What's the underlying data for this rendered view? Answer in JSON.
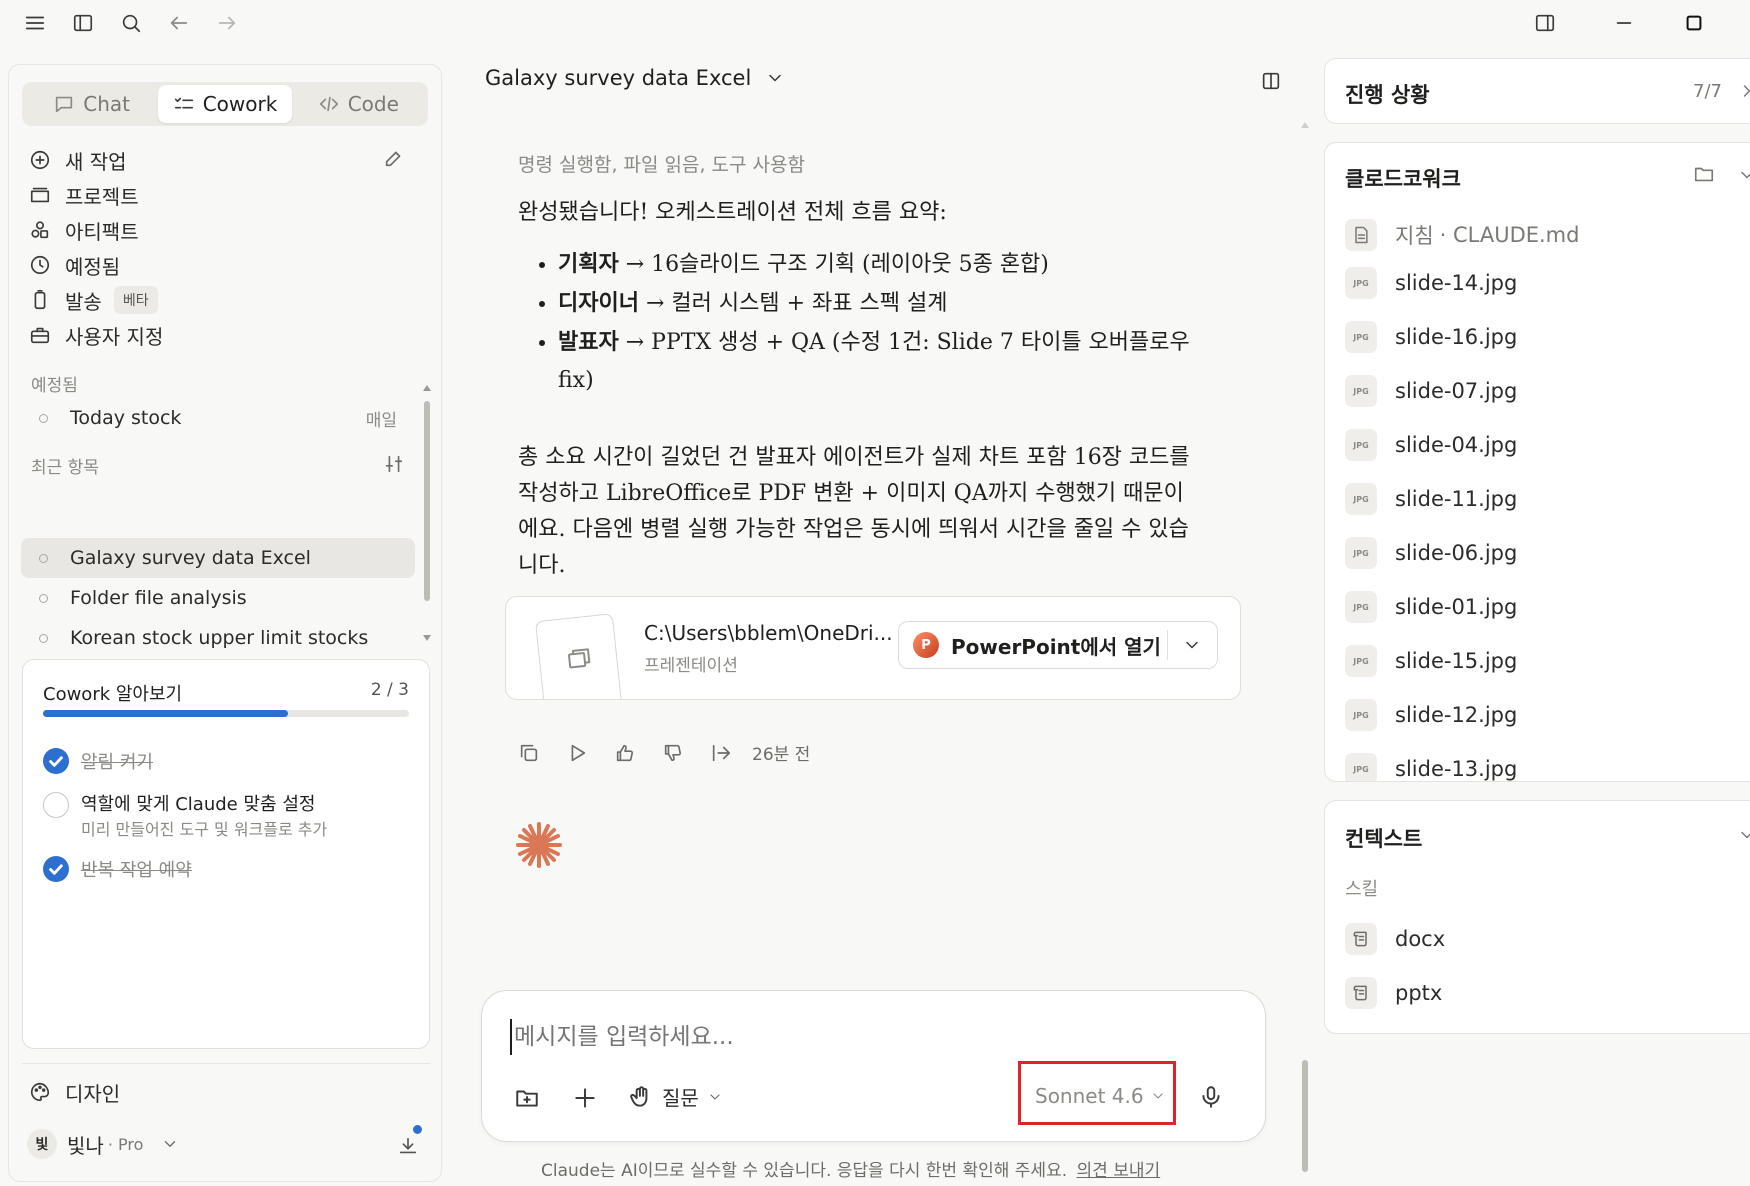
{
  "chat_title": "Galaxy survey data Excel",
  "mode_tabs": [
    {
      "label": "Chat",
      "icon": "chat-bubble-icon"
    },
    {
      "label": "Cowork",
      "icon": "checklist-icon"
    },
    {
      "label": "Code",
      "icon": "code-icon"
    }
  ],
  "nav": {
    "new_task": "새 작업",
    "projects": "프로젝트",
    "artifacts": "아티팩트",
    "scheduled": "예정됨",
    "dispatch": "발송",
    "dispatch_badge": "베타",
    "customize": "사용자 지정"
  },
  "scheduled_section": {
    "label": "예정됨",
    "items": [
      {
        "name": "Today stock",
        "freq": "매일"
      }
    ]
  },
  "recent_section": {
    "label": "최근 항목",
    "items": [
      "Galaxy survey data Excel",
      "Folder file analysis",
      "Korean stock upper limit stocks"
    ]
  },
  "onboarding": {
    "title": "Cowork 알아보기",
    "progress_text": "2 / 3",
    "progress": 0.67,
    "steps": [
      {
        "label": "알림 켜기",
        "done": true
      },
      {
        "label": "역할에 맞게 Claude 맞춤 설정",
        "sub": "미리 만들어진 도구 및 워크플로 추가",
        "done": false
      },
      {
        "label": "반복 작업 예약",
        "done": true
      }
    ]
  },
  "sidebar_footer": {
    "design": "디자인",
    "user_avatar": "빛",
    "user_name": "빛나",
    "plan": "· Pro"
  },
  "message": {
    "tool_summary": "명령 실행함, 파일 읽음, 도구 사용함",
    "intro": "완성됐습니다! 오케스트레이션 전체 흐름 요약:",
    "bullets": [
      {
        "role": "기획자",
        "text": "→ 16슬라이드 구조 기획 (레이아웃 5종 혼합)"
      },
      {
        "role": "디자이너",
        "text": "→ 컬러 시스템 + 좌표 스펙 설계"
      },
      {
        "role": "발표자",
        "text": "→ PPTX 생성 + QA (수정 1건: Slide 7 타이틀 오버플로우 fix)"
      }
    ],
    "paragraph": "총 소요 시간이 길었던 건 발표자 에이전트가 실제 차트 포함 16장 코드를 작성하고 LibreOffice로 PDF 변환 + 이미지 QA까지 수행했기 때문이에요. 다음엔 병렬 실행 가능한 작업은 동시에 띄워서 시간을 줄일 수 있습니다.",
    "file_path": "C:\\Users\\bblem\\OneDri...",
    "file_type": "프레젠테이션",
    "open_button": "PowerPoint에서 열기",
    "timestamp": "26분 전"
  },
  "composer": {
    "placeholder": "메시지를 입력하세요...",
    "mode": "질문",
    "model": "Sonnet 4.6"
  },
  "disclaimer": "Claude는 AI이므로 실수할 수 있습니다. 응답을 다시 한번 확인해 주세요.",
  "feedback_link": "의견 보내기",
  "progress_panel": {
    "title": "진행 상황",
    "count": "7/7"
  },
  "workspace_panel": {
    "title": "클로드코워크",
    "instructions": "지침",
    "instructions_file": "· CLAUDE.md",
    "files": [
      "slide-14.jpg",
      "slide-16.jpg",
      "slide-07.jpg",
      "slide-04.jpg",
      "slide-11.jpg",
      "slide-06.jpg",
      "slide-01.jpg",
      "slide-15.jpg",
      "slide-12.jpg",
      "slide-13.jpg"
    ],
    "file_icon_text": "JPG"
  },
  "context_panel": {
    "title": "컨텍스트",
    "skills_label": "스킬",
    "skills": [
      "docx",
      "pptx"
    ]
  },
  "colors": {
    "accent_blue": "#2c6fd1",
    "highlight_red": "#d9262c",
    "claude_orange": "#d97757"
  }
}
